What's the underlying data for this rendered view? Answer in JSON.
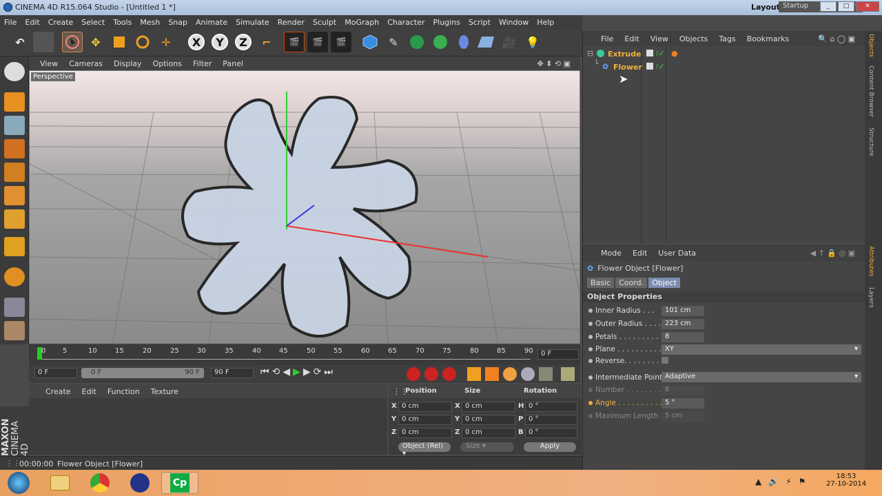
{
  "window": {
    "title": "CINEMA 4D R15.064 Studio - [Untitled 1 *]",
    "layout_label": "Layout:",
    "layout_value": "Startup",
    "buttons": [
      "_",
      "□",
      "✕"
    ]
  },
  "menu": [
    "File",
    "Edit",
    "Create",
    "Select",
    "Tools",
    "Mesh",
    "Snap",
    "Animate",
    "Simulate",
    "Render",
    "Sculpt",
    "MoGraph",
    "Character",
    "Plugins",
    "Script",
    "Window",
    "Help"
  ],
  "toolbar": {
    "x_label": "X",
    "y_label": "Y",
    "z_label": "Z"
  },
  "viewport": {
    "menu": [
      "View",
      "Cameras",
      "Display",
      "Options",
      "Filter",
      "Panel"
    ],
    "label": "Perspective"
  },
  "timeline": {
    "ticks": [
      "0",
      "5",
      "10",
      "15",
      "20",
      "25",
      "30",
      "35",
      "40",
      "45",
      "50",
      "55",
      "60",
      "65",
      "70",
      "75",
      "80",
      "85",
      "90"
    ],
    "current_frame": "0 F"
  },
  "transport": {
    "start": "0 F",
    "range_start": "0 F",
    "range_end": "90 F",
    "end": "90 F"
  },
  "material": {
    "menu": [
      "Create",
      "Edit",
      "Function",
      "Texture"
    ]
  },
  "coords": {
    "headers": [
      "Position",
      "Size",
      "Rotation"
    ],
    "rows": [
      {
        "axis": "X",
        "pos": "0 cm",
        "saxis": "X",
        "size": "0 cm",
        "raxis": "H",
        "rot": "0 °"
      },
      {
        "axis": "Y",
        "pos": "0 cm",
        "saxis": "Y",
        "size": "0 cm",
        "raxis": "P",
        "rot": "0 °"
      },
      {
        "axis": "Z",
        "pos": "0 cm",
        "saxis": "Z",
        "size": "0 cm",
        "raxis": "B",
        "rot": "0 °"
      }
    ],
    "mode": "Object (Rel)",
    "size_mode": "Size",
    "apply": "Apply"
  },
  "status": {
    "time": "00:00:00",
    "text": "Flower Object [Flower]"
  },
  "objects": {
    "menu": [
      "File",
      "Edit",
      "View",
      "Objects",
      "Tags",
      "Bookmarks"
    ],
    "items": [
      {
        "name": "Extrude",
        "color": "#f0b040"
      },
      {
        "name": "Flower",
        "color": "#f0b040"
      }
    ]
  },
  "attributes": {
    "menu": [
      "Mode",
      "Edit",
      "User Data"
    ],
    "title": "Flower Object [Flower]",
    "tabs": [
      "Basic",
      "Coord.",
      "Object"
    ],
    "section": "Object Properties",
    "props": [
      {
        "label": "Inner Radius . . .",
        "value": "101 cm"
      },
      {
        "label": "Outer Radius . . . .",
        "value": "223 cm"
      },
      {
        "label": "Petals . . . . . . . . . .",
        "value": "8"
      },
      {
        "label": "Plane . . . . . . . . . .",
        "value": "XY"
      },
      {
        "label": "Reverse. . . . . . . . .",
        "value": ""
      }
    ],
    "intermediate_label": "Intermediate Points",
    "intermediate_value": "Adaptive",
    "number_label": "Number . . . . . . . .",
    "number_value": "8",
    "angle_label": "Angle . . . . . . . . . .",
    "angle_value": "5 °",
    "maxlen_label": "Maximum Length . .",
    "maxlen_value": "5 cm"
  },
  "sidetabs": [
    "Objects",
    "Content Browser",
    "Structure",
    "Attributes",
    "Layers"
  ],
  "logo": {
    "line1": "MAXON",
    "line2": "CINEMA 4D"
  },
  "taskbar": {
    "time": "18:53",
    "date": "27-10-2014",
    "apps": [
      "windows-start",
      "file-explorer",
      "chrome",
      "cinema4d",
      "captivate"
    ],
    "cp_label": "Cp"
  }
}
